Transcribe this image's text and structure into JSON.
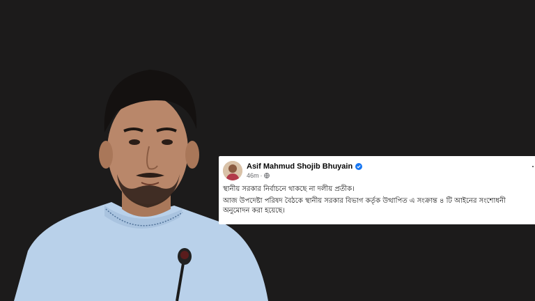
{
  "post": {
    "author": "Asif Mahmud Shojib Bhuyain",
    "time": "46m",
    "separator": "·",
    "headline": "স্থানীয় সরকার নির্বাচনে থাকছে না দলীয় প্রতীক।",
    "body": "আজ উপদেষ্টা পরিষদ বৈঠকে স্থানীয় সরকার বিভাগ কর্তৃক উত্থাপিত এ সংক্রান্ত ৪ টি আইনের সংশোধনী অনুমোদন করা হয়েছে।"
  },
  "icons": {
    "verified": "verified-badge-icon",
    "audience": "globe-icon",
    "menu": "more-options-icon"
  },
  "colors": {
    "background": "#1c1b1b",
    "card": "#ffffff",
    "verified": "#1877f2",
    "shirt": "#bcd3ea"
  }
}
